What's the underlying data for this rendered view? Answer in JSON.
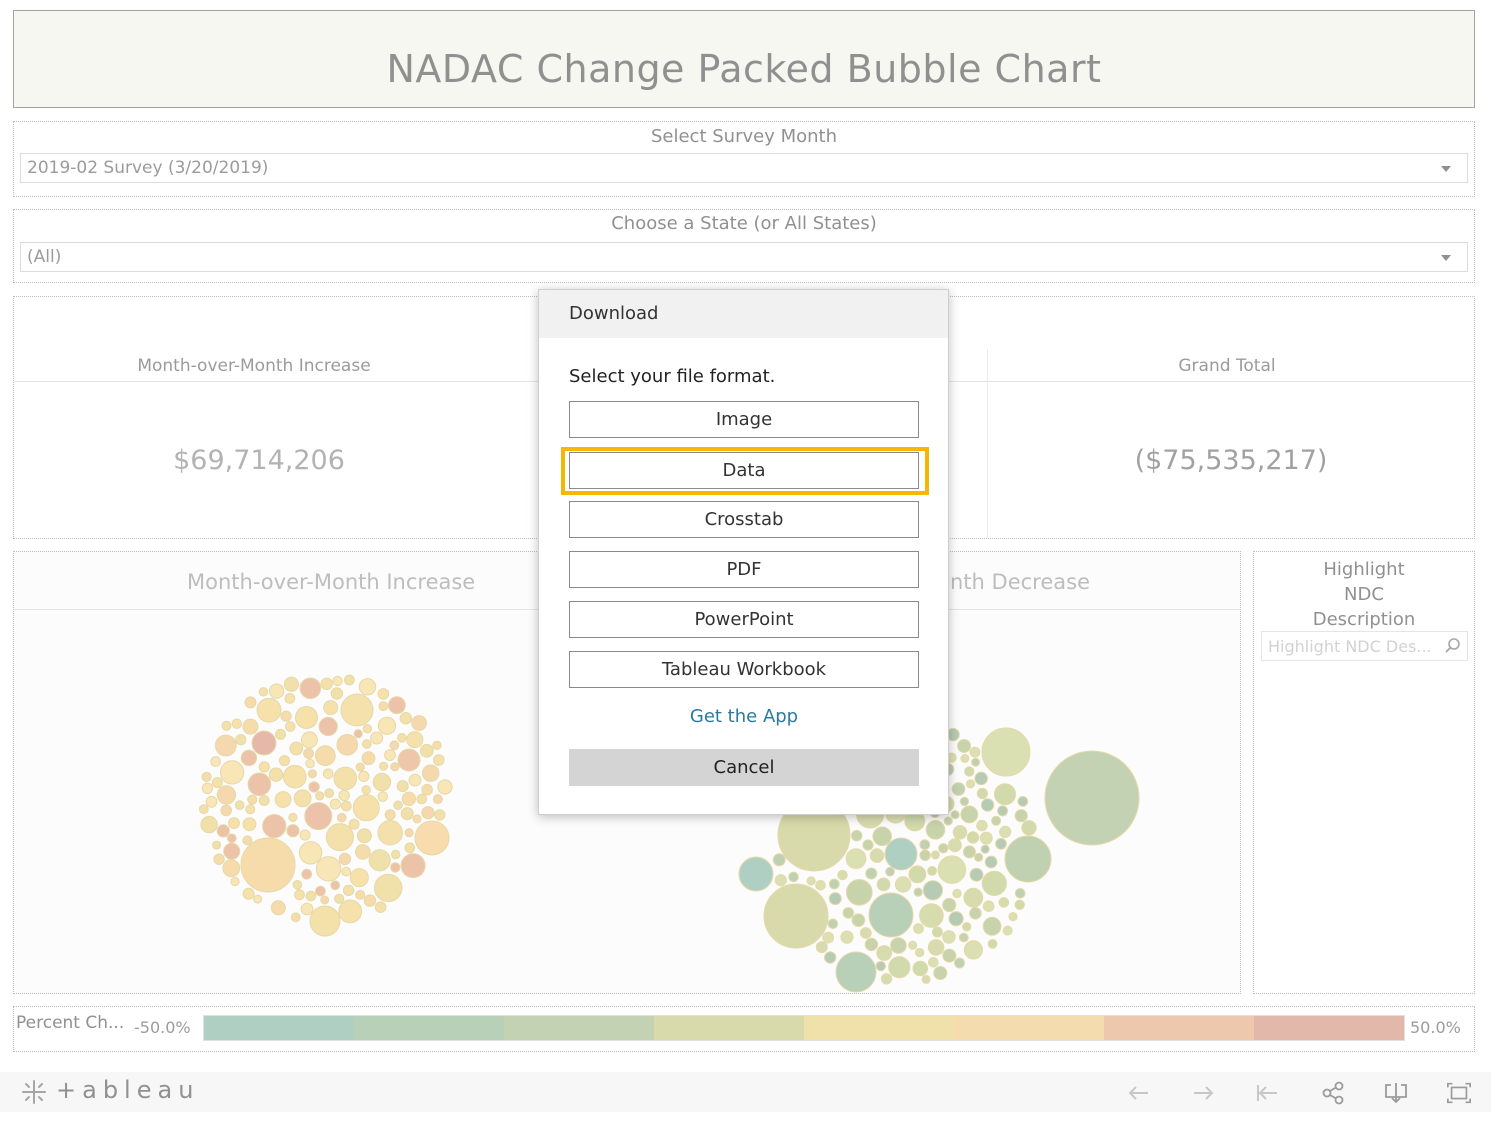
{
  "header": {
    "title": "NADAC Change Packed Bubble Chart"
  },
  "filters": {
    "survey_month": {
      "label": "Select Survey Month",
      "value": "2019-02 Survey (3/20/2019)"
    },
    "state": {
      "label": "Choose a State (or All States)",
      "value": "(All)"
    }
  },
  "kpis": {
    "increase": {
      "label": "Month-over-Month Increase",
      "value": "$69,714,206"
    },
    "grand_total": {
      "label": "Grand Total",
      "value": "($75,535,217)"
    }
  },
  "bubble_panels": {
    "increase_title": "Month-over-Month Increase",
    "decrease_title_visible": "nth Decrease"
  },
  "highlight": {
    "title_lines": [
      "Highlight",
      "NDC",
      "Description"
    ],
    "placeholder": "Highlight NDC Des..."
  },
  "legend": {
    "title": "Percent Ch...",
    "min": "-50.0%",
    "max": "50.0%",
    "colors": [
      "#86b5a3",
      "#93b592",
      "#a3bb8a",
      "#c3c67e",
      "#e8d27e",
      "#f0c985",
      "#e3ab82",
      "#d3927e"
    ]
  },
  "dialog": {
    "title": "Download",
    "prompt": "Select your file format.",
    "buttons": {
      "image": "Image",
      "data": "Data",
      "crosstab": "Crosstab",
      "pdf": "PDF",
      "powerpoint": "PowerPoint",
      "workbook": "Tableau Workbook"
    },
    "get_app": "Get the App",
    "cancel": "Cancel",
    "highlight_color": "#f5b800"
  },
  "toolbar": {
    "logo_text": "+ableau",
    "icons": [
      "undo-icon",
      "redo-icon",
      "revert-icon",
      "share-icon",
      "download-icon",
      "fullscreen-icon"
    ]
  }
}
